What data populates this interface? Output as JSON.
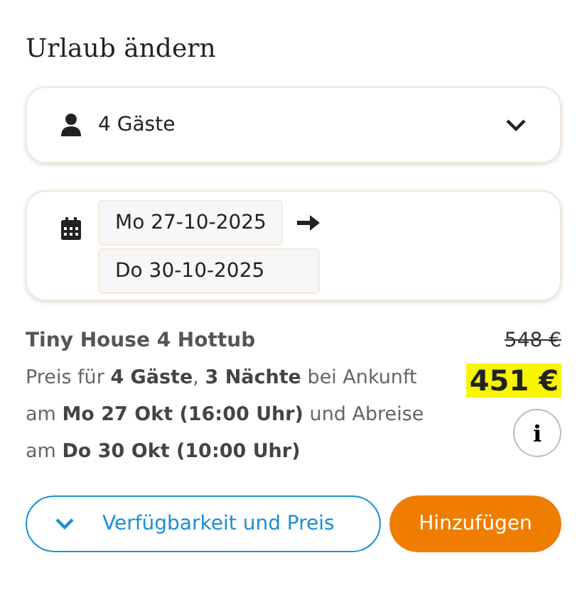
{
  "title": "Urlaub ändern",
  "guests": {
    "value": "4 Gäste"
  },
  "dates": {
    "arrival": "Mo 27-10-2025",
    "departure": "Do 30-10-2025"
  },
  "offer": {
    "name": "Tiny House 4 Hottub",
    "description": "Preis für **4 Gäste**, **3 Nächte** bei Ankunft am **Mo 27 Okt (16:00 Uhr)** und Abreise am **Do 30 Okt (10:00 Uhr)**",
    "old_price": "548 €",
    "price": "451 €",
    "info_button": "i"
  },
  "buttons": [
    {
      "kind": "outline",
      "label": "Verfügbarkeit und Preis"
    },
    {
      "kind": "primary",
      "label": "Hinzufügen"
    }
  ]
}
